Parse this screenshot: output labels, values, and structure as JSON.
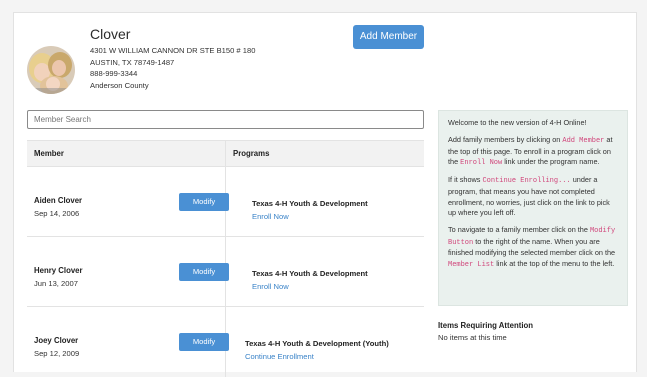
{
  "household": {
    "name": "Clover",
    "address_line1": "4301 W WILLIAM CANNON DR STE B150 # 180",
    "address_line2": "AUSTIN, TX 78749-1487",
    "phone": "888-999-3344",
    "county": "Anderson County"
  },
  "actions": {
    "add_member_label": "Add Member"
  },
  "search": {
    "placeholder": "Member Search",
    "value": ""
  },
  "table": {
    "headers": {
      "member": "Member",
      "programs": "Programs"
    },
    "rows": [
      {
        "name": "Aiden Clover",
        "dob": "Sep 14, 2006",
        "modify_label": "Modify",
        "program": "Texas 4-H Youth & Development",
        "link": "Enroll Now"
      },
      {
        "name": "Henry Clover",
        "dob": "Jun 13, 2007",
        "modify_label": "Modify",
        "program": "Texas 4-H Youth & Development",
        "link": "Enroll Now"
      },
      {
        "name": "Joey Clover",
        "dob": "Sep 12, 2009",
        "modify_label": "Modify",
        "program": "Texas 4-H Youth & Development (Youth)",
        "link": "Continue Enrollment"
      }
    ]
  },
  "info_panel": {
    "welcome": "Welcome to the new version of 4-H Online!",
    "p2_a": "Add family members by clicking on ",
    "p2_code1": "Add Member",
    "p2_b": " at the top of this page. To enroll in a program click on the ",
    "p2_code2": "Enroll Now",
    "p2_c": " link under the program name.",
    "p3_a": "If it shows ",
    "p3_code": "Continue Enrolling...",
    "p3_b": " under a program, that means you have not completed enrollment, no worries, just click on the link to pick up where you left off.",
    "p4_a": "To navigate to a family member click on the ",
    "p4_code1": "Modify Button",
    "p4_b": " to the right of the name. When you are finished modifying the selected member click on the ",
    "p4_code2": "Member List",
    "p4_c": " link at the top of the menu to the left."
  },
  "attention": {
    "title": "Items Requiring Attention",
    "text": "No items at this time"
  }
}
